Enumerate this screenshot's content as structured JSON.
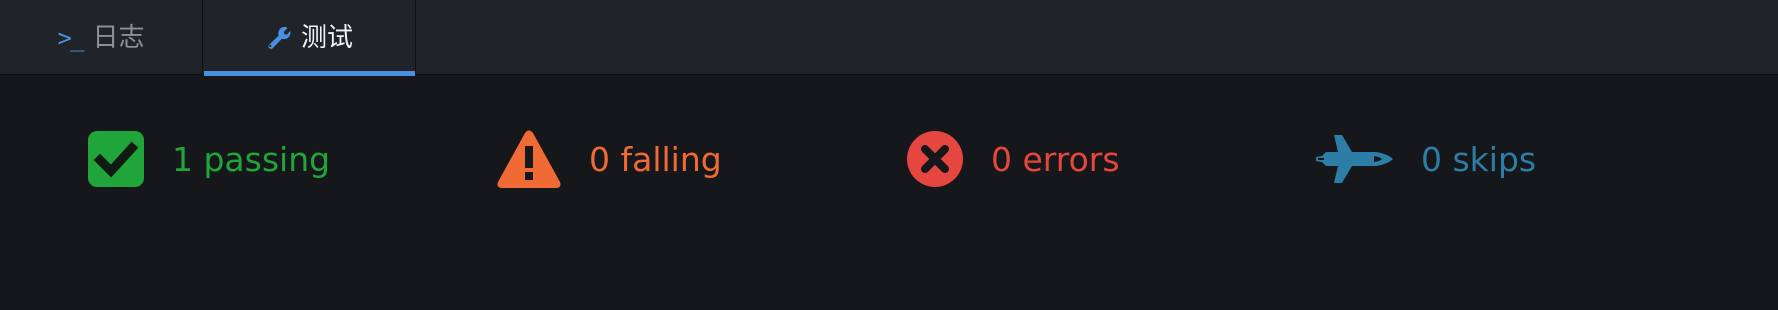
{
  "tabs": [
    {
      "label": "日志",
      "icon": "terminal-icon",
      "active": false
    },
    {
      "label": "测试",
      "icon": "wrench-icon",
      "active": true
    }
  ],
  "summary": {
    "passing": {
      "text": "1 passing",
      "count": 1,
      "icon": "check-square-icon",
      "color": "#1fa53a"
    },
    "failing": {
      "text": "0 falling",
      "count": 0,
      "icon": "warning-triangle-icon",
      "color": "#f06a35"
    },
    "errors": {
      "text": "0 errors",
      "count": 0,
      "icon": "x-circle-icon",
      "color": "#e5463f"
    },
    "skips": {
      "text": "0 skips",
      "count": 0,
      "icon": "space-shuttle-icon",
      "color": "#2d7ea6"
    }
  },
  "colors": {
    "accent": "#4a8fe0",
    "background": "#15171a",
    "tabbar": "#202327"
  }
}
